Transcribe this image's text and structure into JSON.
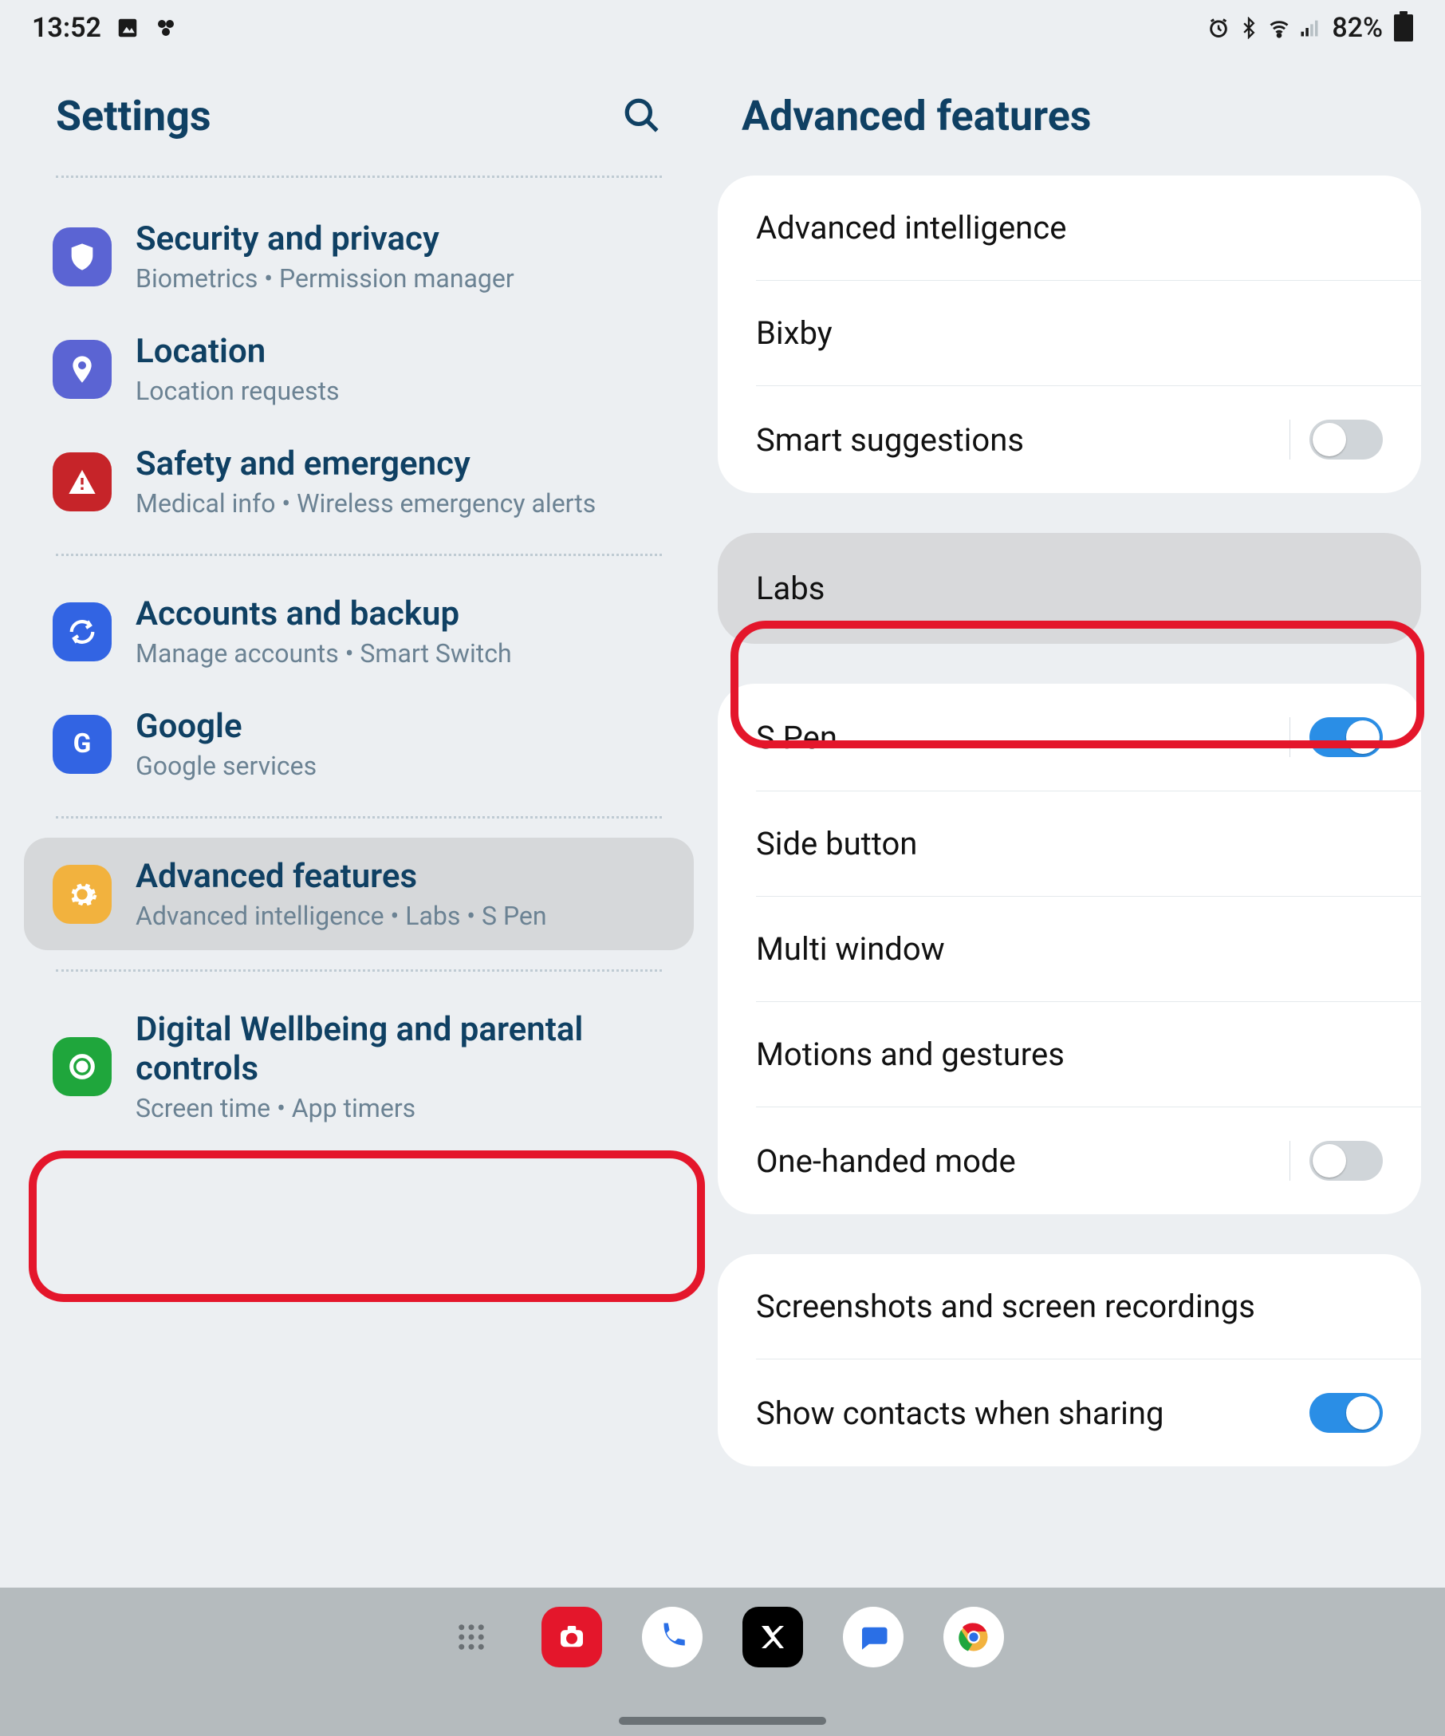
{
  "status": {
    "time": "13:52",
    "battery": "82%"
  },
  "left": {
    "title": "Settings",
    "items": [
      {
        "title": "Security and privacy",
        "subtitle": "Biometrics  •  Permission manager",
        "icon": "shield",
        "color": "indigo"
      },
      {
        "title": "Location",
        "subtitle": "Location requests",
        "icon": "pin",
        "color": "indigo"
      },
      {
        "title": "Safety and emergency",
        "subtitle": "Medical info  •  Wireless emergency alerts",
        "icon": "alert",
        "color": "red"
      },
      {
        "title": "Accounts and backup",
        "subtitle": "Manage accounts  •  Smart Switch",
        "icon": "sync",
        "color": "blue"
      },
      {
        "title": "Google",
        "subtitle": "Google services",
        "icon": "g",
        "color": "blue"
      },
      {
        "title": "Advanced features",
        "subtitle": "Advanced intelligence  •  Labs  •  S Pen",
        "icon": "gear",
        "color": "yellow"
      },
      {
        "title": "Digital Wellbeing and parental controls",
        "subtitle": "Screen time  •  App timers",
        "icon": "wellbeing",
        "color": "green"
      }
    ]
  },
  "right": {
    "title": "Advanced features",
    "group1": {
      "r0": "Advanced intelligence",
      "r1": "Bixby",
      "r2": "Smart suggestions",
      "r2_on": false
    },
    "labs": "Labs",
    "group2": {
      "r0": "S Pen",
      "r0_on": true,
      "r1": "Side button",
      "r2": "Multi window",
      "r3": "Motions and gestures",
      "r4": "One-handed mode",
      "r4_on": false
    },
    "group3": {
      "r0": "Screenshots and screen recordings",
      "r1": "Show contacts when sharing",
      "r1_on": true
    }
  }
}
